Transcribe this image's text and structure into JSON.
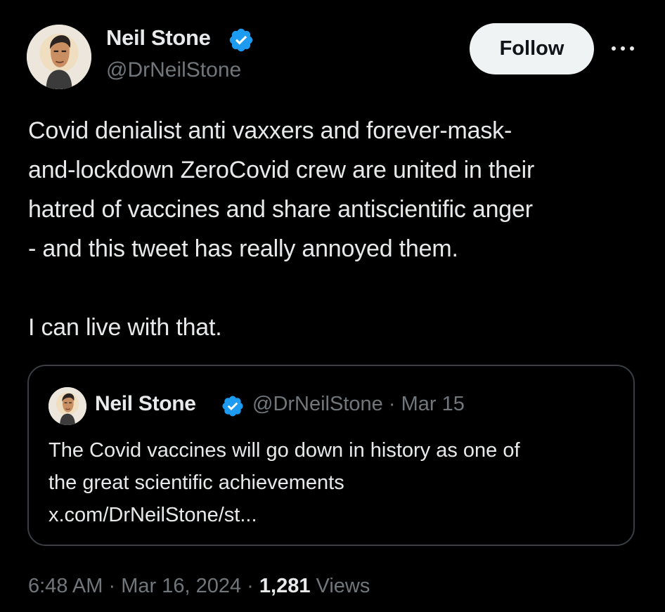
{
  "author": {
    "display_name": "Neil Stone",
    "handle": "@DrNeilStone",
    "verified": true
  },
  "follow_label": "Follow",
  "more_icon": "more-horizontal-icon",
  "tweet": {
    "lines": [
      "Covid denialist anti vaxxers and forever-mask-",
      "and-lockdown ZeroCovid crew are united in their",
      "hatred of vaccines and share antiscientific anger",
      "- and this tweet has really annoyed them."
    ],
    "closing": "I can live with that."
  },
  "quoted_tweet": {
    "display_name": "Neil Stone",
    "handle": "@DrNeilStone",
    "separator": "·",
    "date": "Mar 15",
    "lines": [
      "The Covid vaccines will go down in history as one of",
      "the great scientific achievements",
      "x.com/DrNeilStone/st..."
    ]
  },
  "meta": {
    "time": "6:48 AM",
    "separator": "·",
    "date": "Mar 16, 2024",
    "views_count": "1,281",
    "views_label": "Views"
  },
  "colors": {
    "background": "#000000",
    "text_primary": "#e7e9ea",
    "text_secondary": "#71767b",
    "verified_blue": "#1d9bf0",
    "follow_button_bg": "#eff3f4",
    "follow_button_text": "#0f1419",
    "quote_border": "#3a3e42"
  }
}
